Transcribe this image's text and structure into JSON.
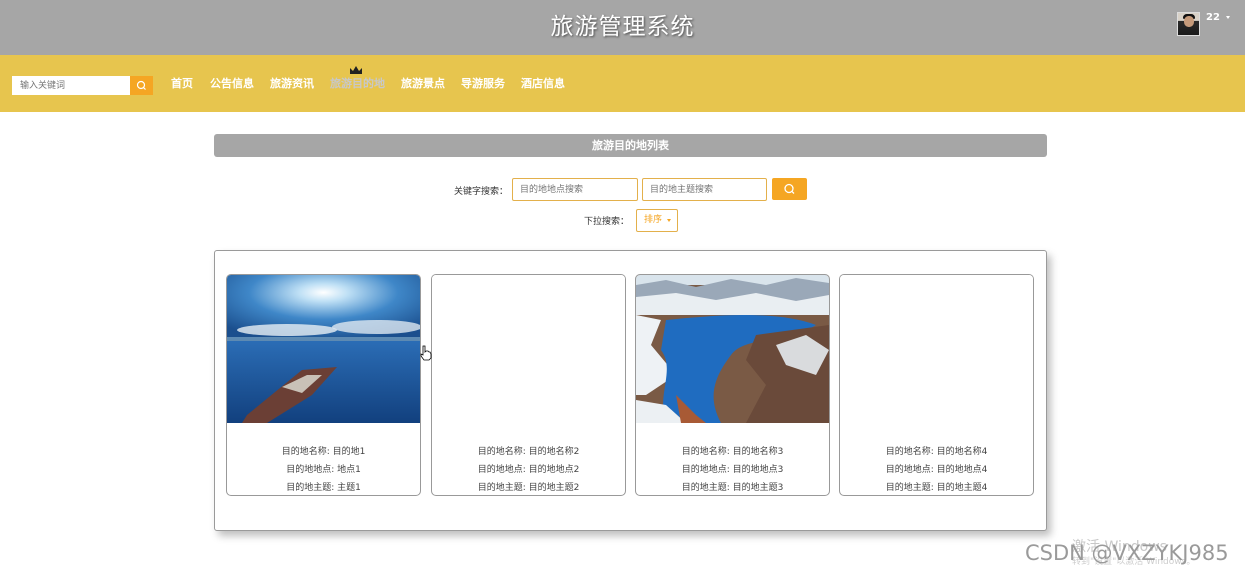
{
  "header": {
    "site_title": "旅游管理系统",
    "user_name": "22",
    "avatar_icon": "user-avatar-photo"
  },
  "nav": {
    "search_placeholder": "输入关键词",
    "search_icon": "search-icon",
    "items": [
      {
        "label": "首页"
      },
      {
        "label": "公告信息"
      },
      {
        "label": "旅游资讯"
      },
      {
        "label": "旅游目的地",
        "active": true
      },
      {
        "label": "旅游景点"
      },
      {
        "label": "导游服务"
      },
      {
        "label": "酒店信息"
      }
    ],
    "active_icon": "crown-icon"
  },
  "colors": {
    "header_bg": "#a6a6a6",
    "nav_bg": "#e7c54e",
    "accent": "#f5a623"
  },
  "main": {
    "list_title": "旅游目的地列表",
    "keyword_label": "关键字搜索：",
    "location_placeholder": "目的地地点搜索",
    "theme_placeholder": "目的地主题搜索",
    "dropdown_label": "下拉搜索：",
    "sort_label": "排序"
  },
  "cards": [
    {
      "image": "sunset-sea-ship-photo",
      "name_line": "目的地名称: 目的地1",
      "location_line": "目的地地点: 地点1",
      "theme_line": "目的地主题: 主题1"
    },
    {
      "image": "",
      "name_line": "目的地名称: 目的地名称2",
      "location_line": "目的地地点: 目的地地点2",
      "theme_line": "目的地主题: 目的地主题2"
    },
    {
      "image": "snowy-river-canyon-photo",
      "name_line": "目的地名称: 目的地名称3",
      "location_line": "目的地地点: 目的地地点3",
      "theme_line": "目的地主题: 目的地主题3"
    },
    {
      "image": "",
      "name_line": "目的地名称: 目的地名称4",
      "location_line": "目的地地点: 目的地地点4",
      "theme_line": "目的地主题: 目的地主题4"
    }
  ],
  "overlay": {
    "activate_windows": "激活 Windows",
    "activate_hint": "转到\"设置\"以激活 Windows。",
    "csdn_watermark": "CSDN @VXZYKJ985"
  }
}
